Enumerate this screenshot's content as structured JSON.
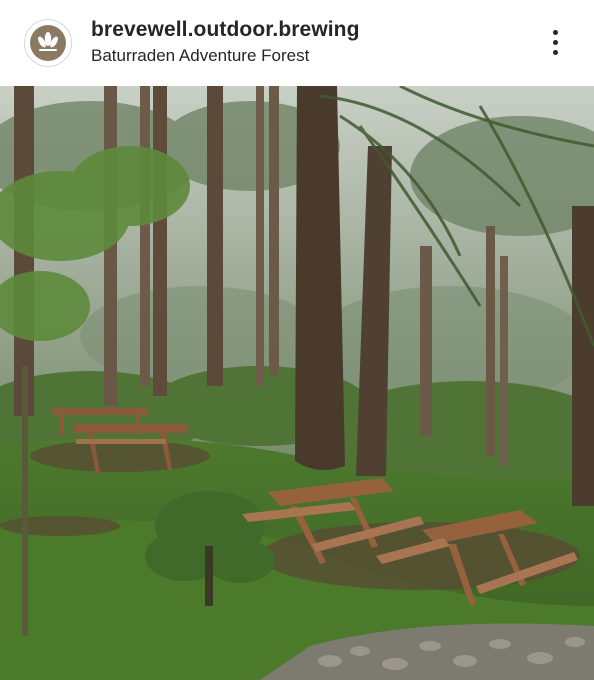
{
  "post": {
    "username": "brevewell.outdoor.brewing",
    "location": "Baturraden Adventure Forest",
    "avatar_icon": "leaf-logo-icon",
    "more_icon": "more-options-icon",
    "photo_description_icon": "forest-picnic-photo"
  },
  "colors": {
    "text": "#262626",
    "avatar_bg": "#8b7a63",
    "border": "#d8d8d8"
  }
}
